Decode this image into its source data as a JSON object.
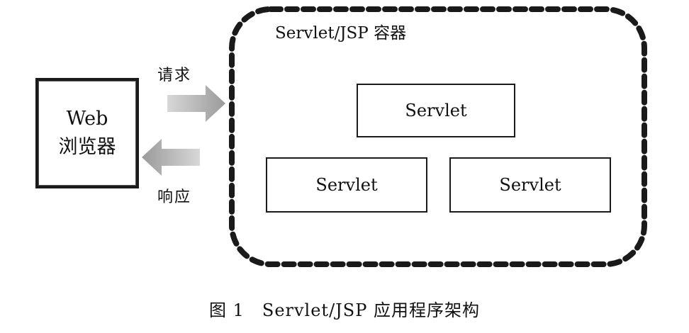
{
  "browser": {
    "line1": "Web",
    "line2": "浏览器"
  },
  "arrows": {
    "request_label": "请求",
    "response_label": "响应"
  },
  "container": {
    "title": "Servlet/JSP 容器",
    "servlets": [
      "Servlet",
      "Servlet",
      "Servlet"
    ]
  },
  "caption": "图 1　Servlet/JSP 应用程序架构"
}
